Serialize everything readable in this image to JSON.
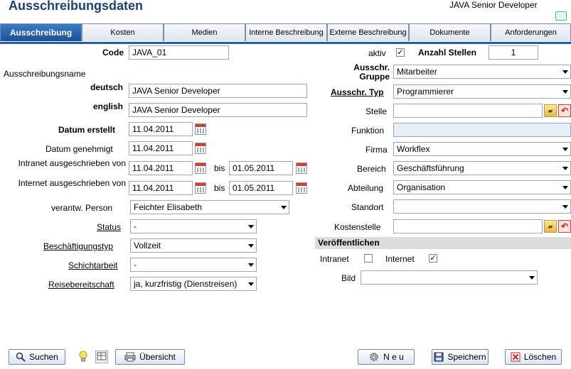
{
  "header": {
    "title": "Ausschreibungsdaten",
    "job_title": "JAVA Senior Developer"
  },
  "tabs": [
    {
      "label": "Ausschreibung"
    },
    {
      "label": "Kosten"
    },
    {
      "label": "Medien"
    },
    {
      "label": "Interne Beschreibung"
    },
    {
      "label": "Externe Beschreibung"
    },
    {
      "label": "Dokumente"
    },
    {
      "label": "Anforderungen"
    }
  ],
  "left": {
    "code_label": "Code",
    "code_value": "JAVA_01",
    "name_label": "Ausschreibungsname",
    "deutsch_label": "deutsch",
    "deutsch_value": "JAVA Senior Developer",
    "english_label": "english",
    "english_value": "JAVA Senior Developer",
    "datum_erstellt_label": "Datum erstellt",
    "datum_erstellt_value": "11.04.2011",
    "datum_genehmigt_label": "Datum genehmigt",
    "datum_genehmigt_value": "11.04.2011",
    "intranet_label": "Intranet ausgeschrieben von",
    "intranet_from": "11.04.2011",
    "intranet_to": "01.05.2011",
    "internet_label": "Internet ausgeschrieben von",
    "internet_from": "11.04.2011",
    "internet_to": "01.05.2011",
    "bis_label": "bis",
    "person_label": "verantw. Person",
    "person_value": "Feichter Elisabeth",
    "status_label": "Status",
    "status_value": "-",
    "beschaeftigung_label": "Beschäftigungstyp",
    "beschaeftigung_value": "Vollzeit",
    "schicht_label": "Schichtarbeit",
    "schicht_value": "-",
    "reise_label": "Reisebereitschaft",
    "reise_value": "ja, kurzfristig (Dienstreisen)"
  },
  "right": {
    "aktiv_label": "aktiv",
    "aktiv_checked": "✓",
    "anzahl_label": "Anzahl Stellen",
    "anzahl_value": "1",
    "gruppe_label": "Ausschr. Gruppe",
    "gruppe_value": "Mitarbeiter",
    "typ_label": "Ausschr. Typ",
    "typ_value": "Programmierer",
    "stelle_label": "Stelle",
    "stelle_value": "",
    "funktion_label": "Funktion",
    "funktion_value": "",
    "firma_label": "Firma",
    "firma_value": "Workflex",
    "bereich_label": "Bereich",
    "bereich_value": "Geschäftsführung",
    "abteilung_label": "Abteilung",
    "abteilung_value": "Organisation",
    "standort_label": "Standort",
    "standort_value": "",
    "kostenstelle_label": "Kostenstelle",
    "kostenstelle_value": "",
    "veroeff_label": "Veröffentlichen",
    "intranet_cb_label": "Intranet",
    "intranet_checked": "",
    "internet_cb_label": "Internet",
    "internet_checked": "✓",
    "bild_label": "Bild",
    "bild_value": ""
  },
  "footer": {
    "suchen": "Suchen",
    "uebersicht": "Übersicht",
    "neu": "N e u",
    "speichern": "Speichern",
    "loeschen": "Löschen"
  }
}
